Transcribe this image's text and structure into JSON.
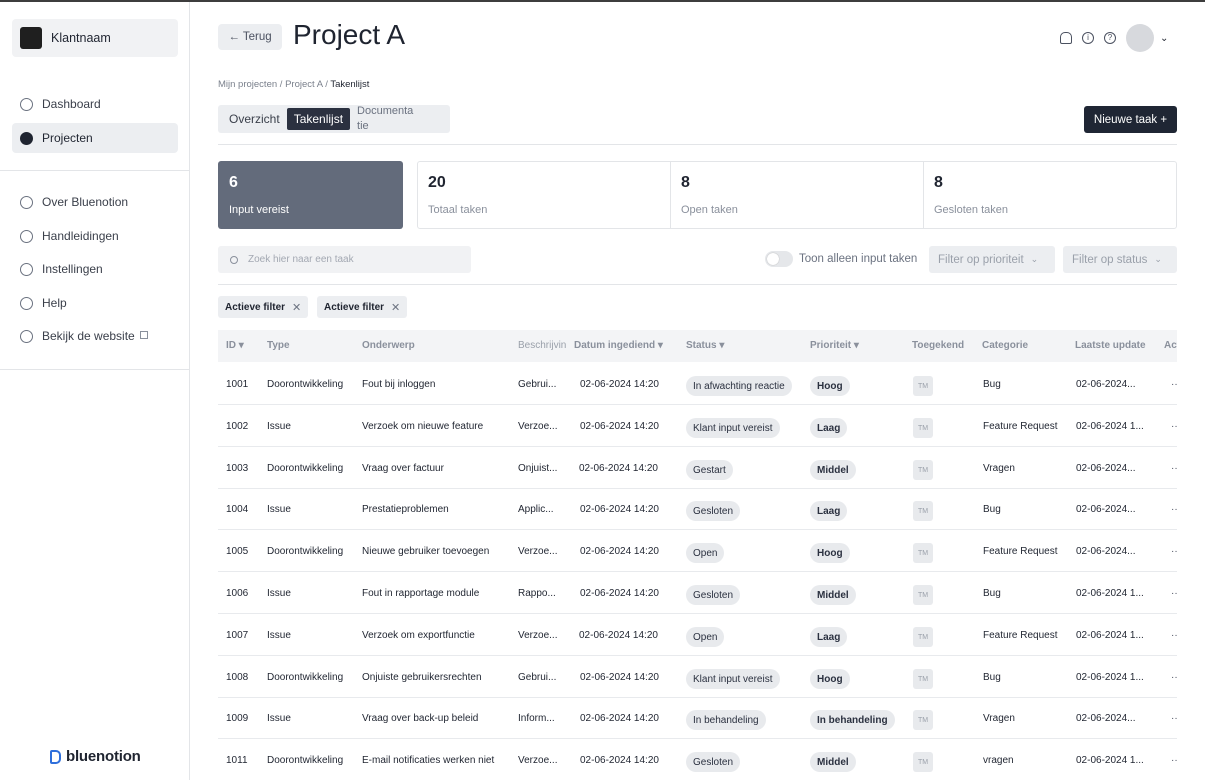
{
  "sidebar": {
    "client_name": "Klantnaam",
    "main_nav": [
      {
        "label": "Dashboard",
        "active": false
      },
      {
        "label": "Projecten",
        "active": true
      }
    ],
    "secondary_nav": [
      {
        "label": "Over Bluenotion"
      },
      {
        "label": "Handleidingen"
      },
      {
        "label": "Instellingen"
      },
      {
        "label": "Help"
      },
      {
        "label": "Bekijk de website",
        "external": true
      }
    ],
    "brand": "bluenotion"
  },
  "header": {
    "back_label": "← Terug",
    "title": "Project A",
    "icons": [
      "bell-icon",
      "info-icon",
      "help-icon"
    ]
  },
  "breadcrumb": {
    "items": [
      "Mijn projecten",
      "Project A",
      "Takenlijst"
    ],
    "separator": " / "
  },
  "tabs": [
    {
      "label": "Overzicht",
      "active": false
    },
    {
      "label": "Takenlijst",
      "active": true
    },
    {
      "label": "Documenta tie",
      "active": false
    }
  ],
  "new_task_label": "Nieuwe taak +",
  "stats": [
    {
      "value": "6",
      "label": "Input vereist",
      "highlight": true
    },
    {
      "value": "20",
      "label": "Totaal taken"
    },
    {
      "value": "8",
      "label": "Open taken"
    },
    {
      "value": "8",
      "label": "Gesloten taken"
    }
  ],
  "filters": {
    "search_placeholder": "Zoek hier naar een taak",
    "toggle_label": "Toon alleen input taken",
    "toggle_on": false,
    "priority_label": "Filter op prioriteit",
    "status_label": "Filter op status",
    "chips": [
      "Actieve filter",
      "Actieve filter"
    ]
  },
  "table": {
    "columns": {
      "id": "ID ▾",
      "type": "Type",
      "subject": "Onderwerp",
      "description": "Beschrijving",
      "date": "Datum ingediend ▾",
      "status": "Status ▾",
      "priority": "Prioriteit ▾",
      "assigned": "Toegekend",
      "category": "Categorie",
      "updated": "Laatste update",
      "actions": "Acties"
    },
    "rows": [
      {
        "id": "1001",
        "type": "Doorontwikkeling",
        "subject": "Fout bij inloggen",
        "desc": "Gebrui...",
        "date": "02-06-2024 14:20",
        "status": "In afwachting reactie",
        "priority": "Hoog",
        "assigned": "TM",
        "category": "Bug",
        "updated": "02-06-2024...",
        "actions": "··"
      },
      {
        "id": "1002",
        "type": "Issue",
        "subject": "Verzoek om nieuwe feature",
        "desc": "Verzoe...",
        "date": "02-06-2024 14:20",
        "status": "Klant input vereist",
        "priority": "Laag",
        "assigned": "TM",
        "category": "Feature Request",
        "updated": "02-06-2024 1...",
        "actions": "··"
      },
      {
        "id": "1003",
        "type": "Doorontwikkeling",
        "subject": "Vraag over factuur",
        "desc": "Onjuist...",
        "date": "02-06-2024 14:20",
        "status": "Gestart",
        "priority": "Middel",
        "assigned": "TM",
        "category": "Vragen",
        "updated": "02-06-2024...",
        "actions": "··"
      },
      {
        "id": "1004",
        "type": "Issue",
        "subject": "Prestatieproblemen",
        "desc": "Applic...",
        "date": "02-06-2024 14:20",
        "status": "Gesloten",
        "priority": "Laag",
        "assigned": "TM",
        "category": "Bug",
        "updated": "02-06-2024...",
        "actions": "··"
      },
      {
        "id": "1005",
        "type": "Doorontwikkeling",
        "subject": "Nieuwe gebruiker toevoegen",
        "desc": "Verzoe...",
        "date": "02-06-2024 14:20",
        "status": "Open",
        "priority": "Hoog",
        "assigned": "TM",
        "category": "Feature Request",
        "updated": "02-06-2024...",
        "actions": "··"
      },
      {
        "id": "1006",
        "type": "Issue",
        "subject": "Fout in rapportage module",
        "desc": "Rappo...",
        "date": "02-06-2024 14:20",
        "status": "Gesloten",
        "priority": "Middel",
        "assigned": "TM",
        "category": "Bug",
        "updated": "02-06-2024 1...",
        "actions": "··"
      },
      {
        "id": "1007",
        "type": "Issue",
        "subject": "Verzoek om exportfunctie",
        "desc": "Verzoe...",
        "date": "02-06-2024 14:20",
        "status": "Open",
        "priority": "Laag",
        "assigned": "TM",
        "category": "Feature Request",
        "updated": "02-06-2024 1...",
        "actions": "··"
      },
      {
        "id": "1008",
        "type": "Doorontwikkeling",
        "subject": "Onjuiste gebruikersrechten",
        "desc": "Gebrui...",
        "date": "02-06-2024 14:20",
        "status": "Klant input vereist",
        "priority": "Hoog",
        "assigned": "TM",
        "category": "Bug",
        "updated": "02-06-2024 1...",
        "actions": "··"
      },
      {
        "id": "1009",
        "type": "Issue",
        "subject": "Vraag over back-up beleid",
        "desc": "Inform...",
        "date": "02-06-2024 14:20",
        "status": "In behandeling",
        "priority": "In behandeling",
        "assigned": "TM",
        "category": "Vragen",
        "updated": "02-06-2024...",
        "actions": "··"
      },
      {
        "id": "1011",
        "type": "Doorontwikkeling",
        "subject": "E-mail notificaties werken niet",
        "desc": "Verzoe...",
        "date": "02-06-2024 14:20",
        "status": "Gesloten",
        "priority": "Middel",
        "assigned": "TM",
        "category": "vragen",
        "updated": "02-06-2024 1...",
        "actions": "··"
      }
    ]
  },
  "colors": {
    "primary_dark": "#1f2634",
    "stat_highlight": "#636b7b",
    "pill_bg": "#e8eaed",
    "brand_blue": "#2f6fdb"
  }
}
